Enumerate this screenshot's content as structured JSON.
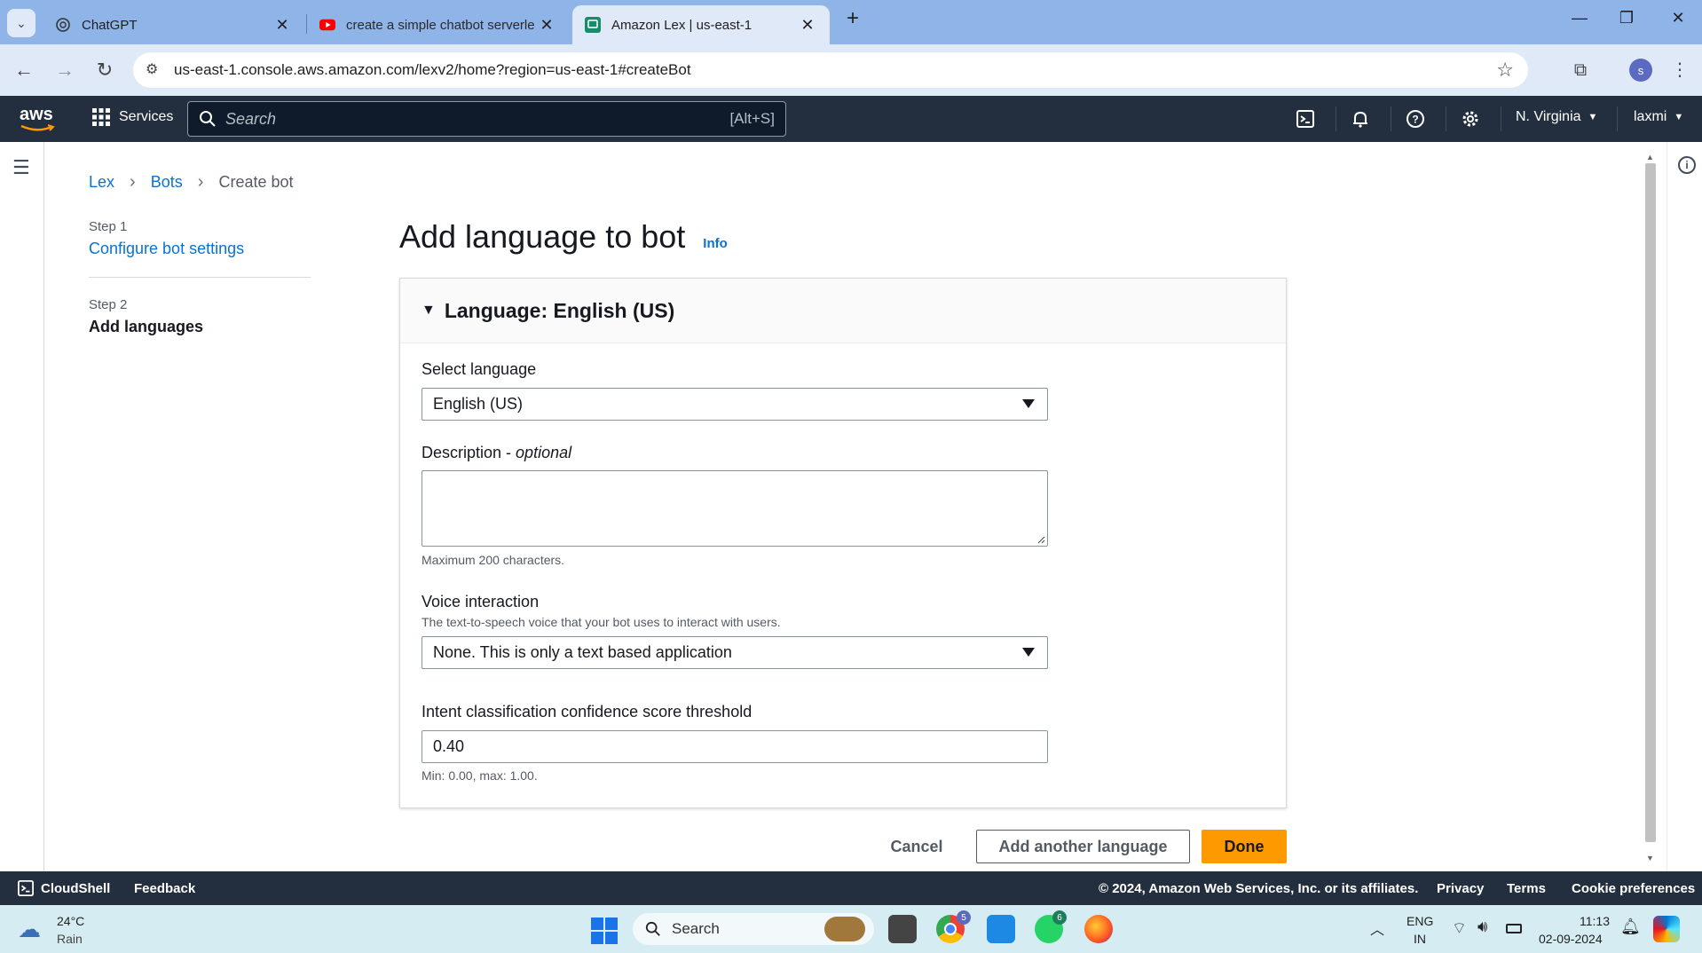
{
  "browser": {
    "tabs": [
      {
        "title": "ChatGPT"
      },
      {
        "title": "create a simple chatbot serverle"
      },
      {
        "title": "Amazon Lex | us-east-1"
      }
    ],
    "url": "us-east-1.console.aws.amazon.com/lexv2/home?region=us-east-1#createBot",
    "profile_initial": "s"
  },
  "aws_header": {
    "logo": "aws",
    "services": "Services",
    "search_placeholder": "Search",
    "search_shortcut": "[Alt+S]",
    "region": "N. Virginia",
    "user": "laxmi"
  },
  "breadcrumb": [
    "Lex",
    "Bots",
    "Create bot"
  ],
  "steps": [
    {
      "label": "Step 1",
      "title": "Configure bot settings"
    },
    {
      "label": "Step 2",
      "title": "Add languages"
    }
  ],
  "page": {
    "title": "Add language to bot",
    "info": "Info"
  },
  "card": {
    "header": "Language: English (US)",
    "select_language_label": "Select language",
    "select_language_value": "English (US)",
    "description_label": "Description -",
    "description_optional": "optional",
    "description_hint": "Maximum 200 characters.",
    "voice_label": "Voice interaction",
    "voice_desc": "The text-to-speech voice that your bot uses to interact with users.",
    "voice_value": "None. This is only a text based application",
    "threshold_label": "Intent classification confidence score threshold",
    "threshold_value": "0.40",
    "threshold_hint": "Min: 0.00, max: 1.00."
  },
  "actions": {
    "cancel": "Cancel",
    "add_another": "Add another language",
    "done": "Done"
  },
  "footer": {
    "cloudshell": "CloudShell",
    "feedback": "Feedback",
    "copyright": "© 2024, Amazon Web Services, Inc. or its affiliates.",
    "privacy": "Privacy",
    "terms": "Terms",
    "cookies": "Cookie preferences"
  },
  "taskbar": {
    "temp": "24°C",
    "weather": "Rain",
    "search": "Search",
    "chrome_badge": "5",
    "whatsapp_badge": "6",
    "lang1": "ENG",
    "lang2": "IN",
    "time": "11:13",
    "date": "02-09-2024"
  },
  "colors": {
    "aws_header": "#232f3e",
    "link": "#0972d3",
    "primary_button": "#ff9900"
  }
}
